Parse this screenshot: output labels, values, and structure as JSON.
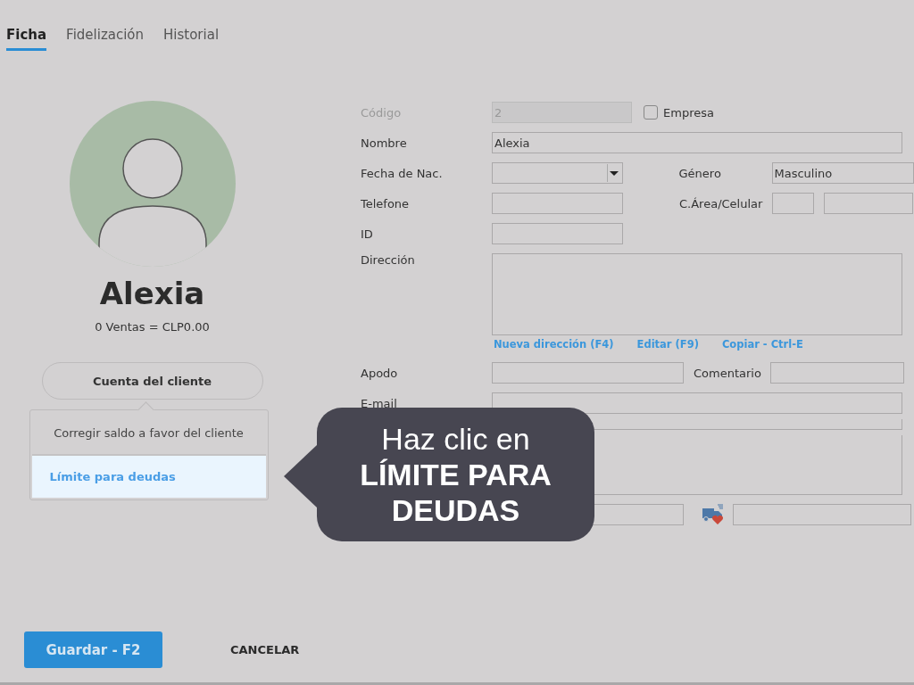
{
  "tabs": [
    {
      "label": "Ficha",
      "selected": true
    },
    {
      "label": "Fidelización",
      "selected": false
    },
    {
      "label": "Historial",
      "selected": false
    }
  ],
  "profile": {
    "name": "Alexia",
    "sales": "0 Ventas = CLP0.00",
    "account_button": "Cuenta del cliente"
  },
  "account_menu": [
    {
      "label": "Corregir saldo a favor del cliente",
      "selected": false
    },
    {
      "label": "Límite para deudas",
      "selected": true
    }
  ],
  "form": {
    "code": {
      "label": "Código",
      "value": "2",
      "disabled": true
    },
    "company": {
      "label": "Empresa",
      "checked": false
    },
    "name": {
      "label": "Nombre",
      "value": "Alexia"
    },
    "birth_date": {
      "label": "Fecha de Nac."
    },
    "gender": {
      "label": "Género",
      "value": "Masculino"
    },
    "phone": {
      "label": "Telefone"
    },
    "mobile": {
      "label": "C.Área/Celular"
    },
    "id": {
      "label": "ID"
    },
    "address": {
      "label": "Dirección"
    },
    "address_links": [
      "Nueva dirección (F4)",
      "Editar (F9)",
      "Copiar - Ctrl-E"
    ],
    "nickname": {
      "label": "Apodo"
    },
    "comment": {
      "label": "Comentario"
    },
    "email": {
      "label": "E-mail"
    }
  },
  "callout": {
    "text": "Haz clic en **LÍMITE PARA DEUDAS**"
  },
  "buttons": [
    {
      "label": "Guardar - F2",
      "kind": "primary"
    },
    {
      "label": "CANCELAR",
      "kind": "text"
    }
  ]
}
